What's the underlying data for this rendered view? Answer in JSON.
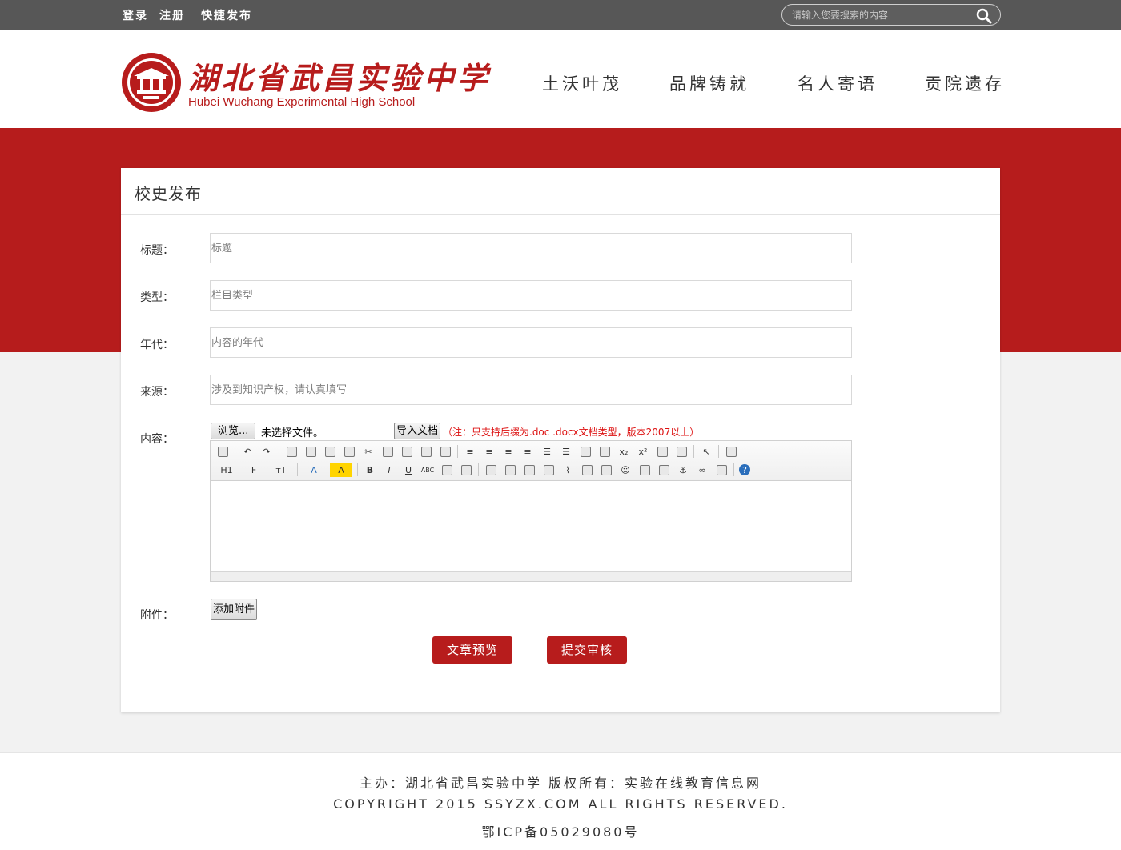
{
  "topbar": {
    "login": "登录",
    "register": "注册",
    "quick_publish": "快捷发布",
    "search_placeholder": "请输入您要搜索的内容",
    "search_icon": "search-icon"
  },
  "header": {
    "logo_cn": "湖北省武昌实验中学",
    "logo_en": "Hubei Wuchang Experimental High School",
    "nav": [
      "土沃叶茂",
      "品牌铸就",
      "名人寄语",
      "贡院遗存"
    ]
  },
  "form": {
    "title": "校史发布",
    "fields": [
      {
        "label": "标题：",
        "placeholder": "标题"
      },
      {
        "label": "类型：",
        "placeholder": "栏目类型"
      },
      {
        "label": "年代：",
        "placeholder": "内容的年代"
      },
      {
        "label": "来源：",
        "placeholder": "涉及到知识产权，请认真填写"
      }
    ],
    "content_label": "内容：",
    "browse_label": "浏览...",
    "file_status": "未选择文件。",
    "import_label": "导入文档",
    "import_note": "（注：只支持后缀为.doc .docx文档类型，版本2007以上）",
    "editor_toolbar_row1": [
      "source-icon",
      "undo-icon",
      "redo-icon",
      "preview-icon",
      "print-icon",
      "template-icon",
      "code-icon",
      "cut-icon",
      "copy-icon",
      "paste-icon",
      "paste-text-icon",
      "paste-word-icon",
      "align-left-icon",
      "align-center-icon",
      "align-right-icon",
      "justify-icon",
      "ordered-list-icon",
      "unordered-list-icon",
      "indent-icon",
      "outdent-icon",
      "subscript-icon",
      "superscript-icon",
      "clear-format-icon",
      "select-all-icon",
      "select-icon",
      "fullscreen-icon"
    ],
    "editor_toolbar_row2": [
      "heading-icon",
      "font-family-icon",
      "font-size-icon",
      "font-color-icon",
      "highlight-icon",
      "bold-icon",
      "italic-icon",
      "underline-icon",
      "strikethrough-icon",
      "line-height-icon",
      "eraser-icon",
      "image-icon",
      "multi-image-icon",
      "flash-icon",
      "media-icon",
      "attachment-icon",
      "table-icon",
      "hr-icon",
      "emoticon-icon",
      "map-icon",
      "pagebreak-icon",
      "anchor-icon",
      "link-icon",
      "unlink-icon",
      "about-icon"
    ],
    "attachment_label": "附件：",
    "add_attachment": "添加附件",
    "preview_button": "文章预览",
    "submit_button": "提交审核"
  },
  "footer": {
    "line1": "主办：湖北省武昌实验中学 版权所有：实验在线教育信息网",
    "line2": "COPYRIGHT 2015 SSYZX.COM ALL RIGHTS RESERVED.",
    "line3": "鄂ICP备05029080号"
  },
  "colors": {
    "topbar": "#575757",
    "brand_red": "#b61c1c",
    "page_bg": "#f2f2f2",
    "note_red": "#dd1111"
  }
}
